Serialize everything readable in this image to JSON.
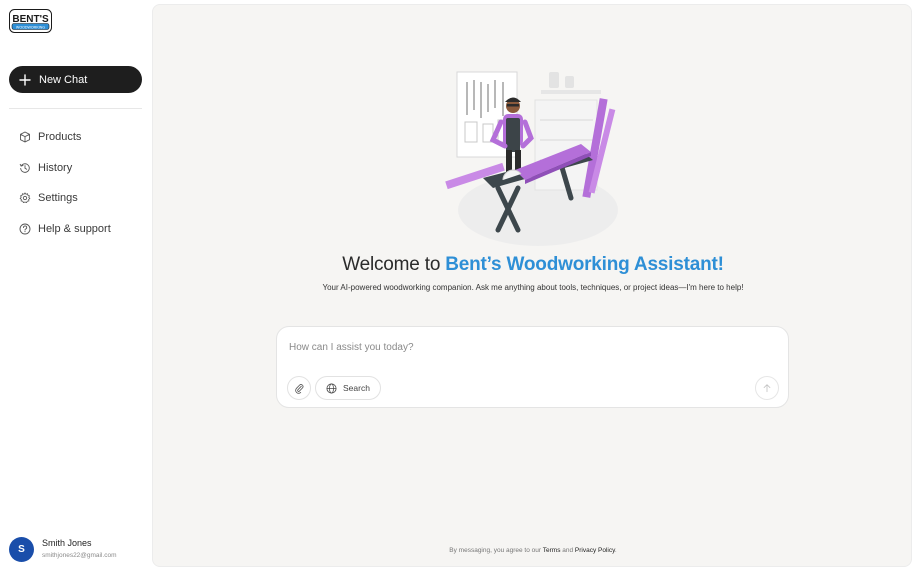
{
  "app": {
    "logo_text": "BENT'S",
    "logo_subtext": "WOODWORKING"
  },
  "sidebar": {
    "new_chat_label": "New Chat",
    "items": [
      {
        "label": "Products",
        "icon": "box-icon"
      },
      {
        "label": "History",
        "icon": "history-icon"
      },
      {
        "label": "Settings",
        "icon": "gear-icon"
      },
      {
        "label": "Help & support",
        "icon": "help-icon"
      }
    ],
    "user": {
      "initial": "S",
      "name": "Smith Jones",
      "email": "smithjones22@gmail.com"
    }
  },
  "main": {
    "welcome_prefix": "Welcome to ",
    "welcome_brand": "Bent’s Woodworking Assistant!",
    "tagline": "Your AI-powered woodworking companion. Ask me anything about tools, techniques, or project ideas—I'm here to help!",
    "composer": {
      "placeholder": "How can I assist you today?",
      "search_label": "Search"
    },
    "legal": {
      "prefix": "By messaging, you agree to our ",
      "terms": "Terms",
      "and": " and ",
      "privacy": "Privacy Policy",
      "suffix": "."
    }
  },
  "colors": {
    "brand_blue": "#2e8fd6",
    "avatar_blue": "#1a4eaa",
    "accent_purple": "#b46fd9",
    "new_chat_bg": "#1e1e1e"
  }
}
